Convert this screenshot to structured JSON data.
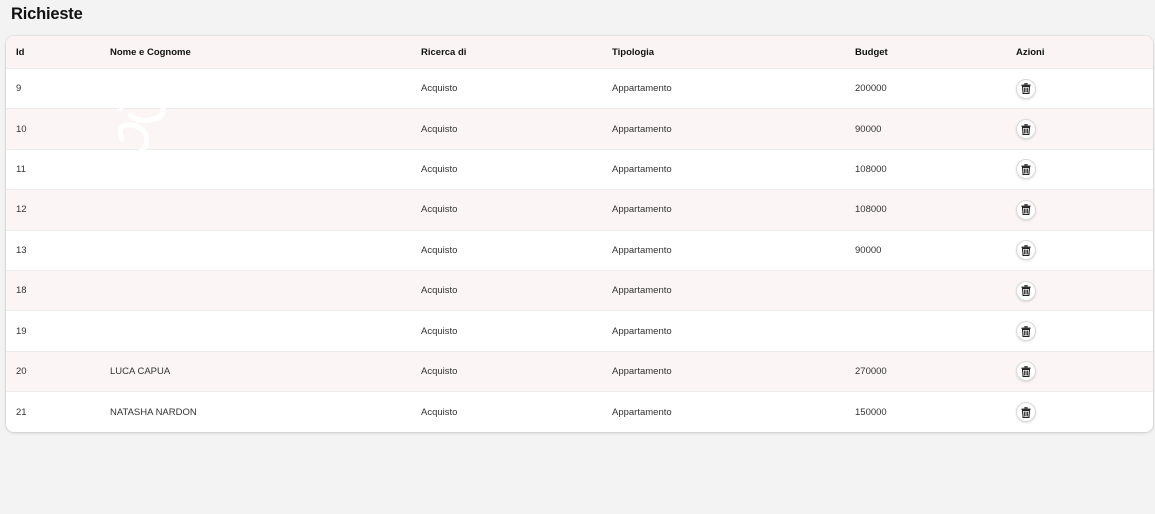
{
  "page": {
    "title": "Richieste"
  },
  "table": {
    "headers": {
      "id": "Id",
      "name": "Nome e Cognome",
      "ricerca": "Ricerca di",
      "tipologia": "Tipologia",
      "budget": "Budget",
      "azioni": "Azioni"
    },
    "rows": [
      {
        "id": "9",
        "name": "",
        "ricerca": "Acquisto",
        "tipologia": "Appartamento",
        "budget": "200000"
      },
      {
        "id": "10",
        "name": "",
        "ricerca": "Acquisto",
        "tipologia": "Appartamento",
        "budget": "90000"
      },
      {
        "id": "11",
        "name": "",
        "ricerca": "Acquisto",
        "tipologia": "Appartamento",
        "budget": "108000"
      },
      {
        "id": "12",
        "name": "",
        "ricerca": "Acquisto",
        "tipologia": "Appartamento",
        "budget": "108000"
      },
      {
        "id": "13",
        "name": "",
        "ricerca": "Acquisto",
        "tipologia": "Appartamento",
        "budget": "90000"
      },
      {
        "id": "18",
        "name": "",
        "ricerca": "Acquisto",
        "tipologia": "Appartamento",
        "budget": ""
      },
      {
        "id": "19",
        "name": "",
        "ricerca": "Acquisto",
        "tipologia": "Appartamento",
        "budget": ""
      },
      {
        "id": "20",
        "name": "LUCA CAPUA",
        "ricerca": "Acquisto",
        "tipologia": "Appartamento",
        "budget": "270000"
      },
      {
        "id": "21",
        "name": "NATASHA NARDON",
        "ricerca": "Acquisto",
        "tipologia": "Appartamento",
        "budget": "150000"
      }
    ],
    "row_action_icon": "trash-icon"
  },
  "colors": {
    "background": "#f3f3f3",
    "header_bg": "#fbf4f4",
    "alt_row_bg": "#fcf5f5"
  }
}
